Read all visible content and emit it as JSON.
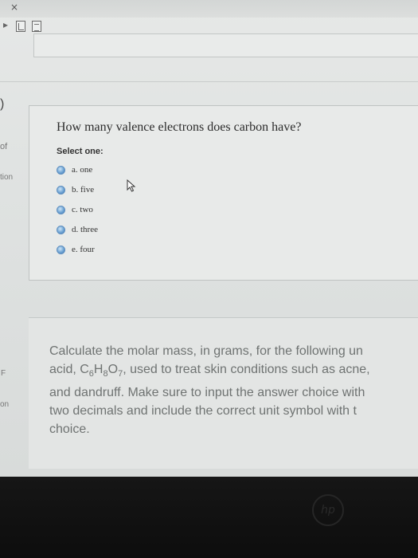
{
  "window": {
    "close_glyph": "×"
  },
  "toolbar": {
    "icons": [
      "back-arrow-icon",
      "pdf-icon",
      "document-icon"
    ]
  },
  "left_fragments": {
    "bracket": ")",
    "of": "of",
    "tion": "tion",
    "f": "F",
    "on": "on"
  },
  "question1": {
    "text": "How many valence electrons does carbon have?",
    "select_label": "Select one:",
    "options": [
      {
        "label": "a. one"
      },
      {
        "label": "b. five"
      },
      {
        "label": "c. two"
      },
      {
        "label": "d. three"
      },
      {
        "label": "e. four"
      }
    ]
  },
  "question2": {
    "line1": "Calculate the molar mass, in grams, for the following un",
    "line2_pre": "acid, C",
    "sub1": "6",
    "mid1": "H",
    "sub2": "8",
    "mid2": "O",
    "sub3": "7",
    "line2_post": ", used to treat skin conditions such as acne,",
    "line3": "and dandruff. Make sure to input the answer choice with",
    "line4": "two decimals and include the correct unit symbol with t",
    "line5": "choice."
  },
  "device": {
    "logo_text": "hp"
  },
  "colors": {
    "radio_accent": "#5f8fbf",
    "question_text": "#2c2c2c",
    "faded_text": "#6f7372"
  }
}
